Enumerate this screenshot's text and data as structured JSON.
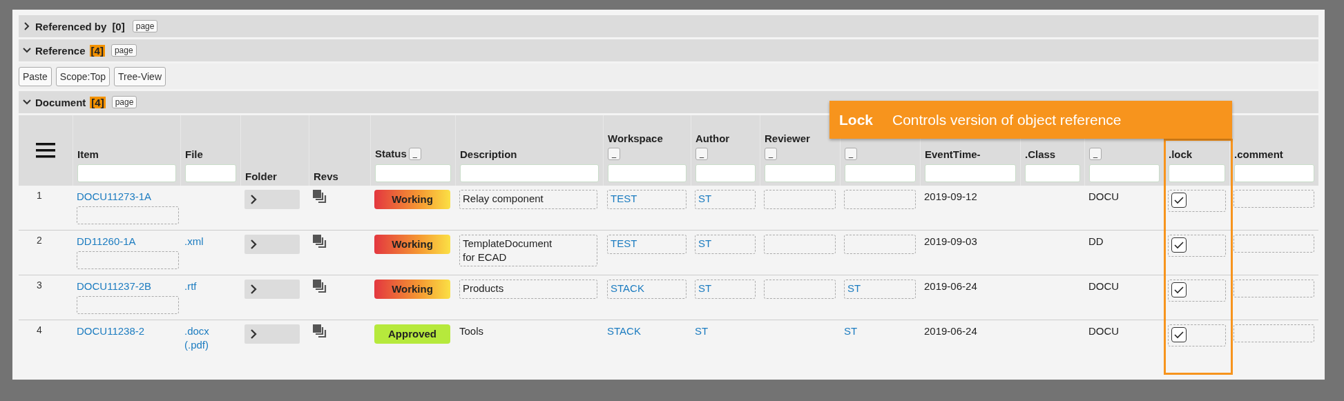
{
  "sections": [
    {
      "title": "Referenced by",
      "count": "[0]",
      "count_highlighted": false,
      "expanded": false,
      "page_button": "page"
    },
    {
      "title": "Reference",
      "count": "[4]",
      "count_highlighted": true,
      "expanded": true,
      "page_button": "page"
    }
  ],
  "toolbar": [
    "Paste",
    "Scope:Top",
    "Tree-View"
  ],
  "document": {
    "title": "Document",
    "count": "[4]",
    "count_highlighted": true,
    "expanded": true,
    "page_button": "page"
  },
  "columns": [
    {
      "input": false
    },
    {
      "label": "Item",
      "input": true
    },
    {
      "label": "File",
      "input": true
    },
    {
      "label": "Folder",
      "input": false
    },
    {
      "label": "Revs",
      "input": false
    },
    {
      "label": "Status",
      "button": "_",
      "button_inline": true,
      "input": true
    },
    {
      "label": "Description",
      "input": true
    },
    {
      "label": "Workspace",
      "button": "_",
      "button_inline": false,
      "input": true
    },
    {
      "label": "Author",
      "button": "_",
      "button_inline": false,
      "input": true
    },
    {
      "label": "Reviewer",
      "button": "_",
      "button_inline": false,
      "input": true
    },
    {
      "button": "_",
      "input": true
    },
    {
      "label": "EventTime-",
      "input": true
    },
    {
      "label": ".Class",
      "input": true
    },
    {
      "button": "_",
      "input": true
    },
    {
      "label": ".lock",
      "input": true,
      "highlighted": true
    },
    {
      "label": ".comment",
      "input": true
    }
  ],
  "rows": [
    {
      "number": "1",
      "item": "DOCU11273-1A",
      "editable": true,
      "status": "Working",
      "approved": false,
      "description": [
        "Relay component"
      ],
      "workspace": "TEST",
      "author": "ST",
      "event_time": "2019-09-12",
      "column_13": "DOCU",
      "lock": true
    },
    {
      "number": "2",
      "item": "DD11260-1A",
      "editable": true,
      "file": [
        ".xml"
      ],
      "status": "Working",
      "approved": false,
      "description": [
        "TemplateDocument",
        "for ECAD"
      ],
      "workspace": "TEST",
      "author": "ST",
      "event_time": "2019-09-03",
      "column_13": "DD",
      "lock": true
    },
    {
      "number": "3",
      "item": "DOCU11237-2B",
      "editable": true,
      "file": [
        ".rtf"
      ],
      "status": "Working",
      "approved": false,
      "description": [
        "Products"
      ],
      "workspace": "STACK",
      "author": "ST",
      "column_10": "ST",
      "event_time": "2019-06-24",
      "column_13": "DOCU",
      "lock": true
    },
    {
      "number": "4",
      "item": "DOCU11238-2",
      "editable": false,
      "file": [
        ".docx",
        "(.pdf)"
      ],
      "status": "Approved",
      "approved": true,
      "description": [
        "Tools"
      ],
      "workspace": "STACK",
      "author": "ST",
      "column_10": "ST",
      "event_time": "2019-06-24",
      "column_13": "DOCU",
      "lock": true
    }
  ],
  "tooltip": {
    "title": "Lock",
    "text": "Controls version of object reference"
  }
}
